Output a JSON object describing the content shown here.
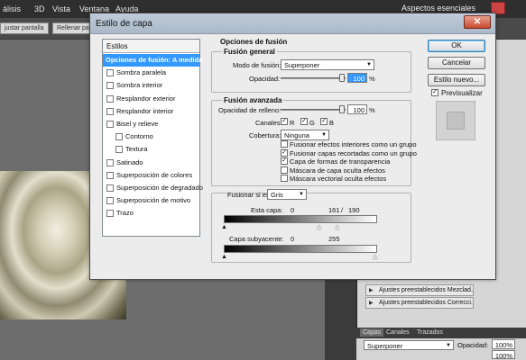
{
  "ps": {
    "menu": [
      "álisis",
      "3D",
      "Vista",
      "Ventana",
      "Ayuda"
    ],
    "essentials": "Aspectos esenciales",
    "options_bar": {
      "adjust_screen": "justar pantalla",
      "fill_screen": "Rellenar pant"
    },
    "adjust_presets": [
      "Ajustes preestablecidos Mezclad...",
      "Ajustes preestablecidos Correcci..."
    ],
    "layers_tabs": [
      "Capas",
      "Canales",
      "Trazados"
    ],
    "blend_mode": "Superponer",
    "opacity_label": "Opacidad:",
    "opacity_value": "100%",
    "fill_value": "100%"
  },
  "dialog": {
    "title": "Estilo de capa",
    "styles_header": "Estilos",
    "styles": [
      {
        "label": "Opciones de fusión: A medida",
        "checkbox": false,
        "selected": true,
        "indent": false
      },
      {
        "label": "Sombra paralela",
        "checkbox": true,
        "checked": false
      },
      {
        "label": "Sombra interior",
        "checkbox": true,
        "checked": false
      },
      {
        "label": "Resplandor exterior",
        "checkbox": true,
        "checked": false
      },
      {
        "label": "Resplandor interior",
        "checkbox": true,
        "checked": false
      },
      {
        "label": "Bisel y relieve",
        "checkbox": true,
        "checked": false
      },
      {
        "label": "Contorno",
        "checkbox": true,
        "checked": false,
        "indent": true
      },
      {
        "label": "Textura",
        "checkbox": true,
        "checked": false,
        "indent": true
      },
      {
        "label": "Satinado",
        "checkbox": true,
        "checked": false
      },
      {
        "label": "Superposición de colores",
        "checkbox": true,
        "checked": false
      },
      {
        "label": "Superposición de degradado",
        "checkbox": true,
        "checked": false
      },
      {
        "label": "Superposición de motivo",
        "checkbox": true,
        "checked": false
      },
      {
        "label": "Trazo",
        "checkbox": true,
        "checked": false
      }
    ],
    "blending": {
      "section_title": "Opciones de fusión",
      "general_title": "Fusión general",
      "mode_label": "Modo de fusión:",
      "mode_value": "Superponer",
      "opacity_label": "Opacidad:",
      "opacity_value": "100",
      "opacity_level": 1.0,
      "percent": "%"
    },
    "advanced": {
      "title": "Fusión avanzada",
      "fill_label": "Opacidad de relleno:",
      "fill_value": "100",
      "fill_level": 1.0,
      "percent": "%",
      "channels_label": "Canales:",
      "channels": [
        "R",
        "G",
        "B"
      ],
      "knockout_label": "Cobertura:",
      "knockout_value": "Ninguna",
      "options": [
        {
          "label": "Fusionar efectos interiores como un grupo",
          "checked": false
        },
        {
          "label": "Fusionar capas recortadas como un grupo",
          "checked": true
        },
        {
          "label": "Capa de formas de transparencia",
          "checked": true
        },
        {
          "label": "Máscara de capa oculta efectos",
          "checked": false
        },
        {
          "label": "Máscara vectorial oculta efectos",
          "checked": false
        }
      ]
    },
    "blend_if": {
      "label": "Fusionar si es:",
      "value": "Gris",
      "this_layer_label": "Esta capa:",
      "this_layer_values": [
        "0",
        "161",
        "/",
        "190"
      ],
      "underlying_label": "Capa subyacente:",
      "underlying_values": [
        "0",
        "255"
      ]
    },
    "buttons": {
      "ok": "OK",
      "cancel": "Cancelar",
      "new_style": "Estilo nuevo...",
      "preview": "Previsualizar"
    }
  }
}
